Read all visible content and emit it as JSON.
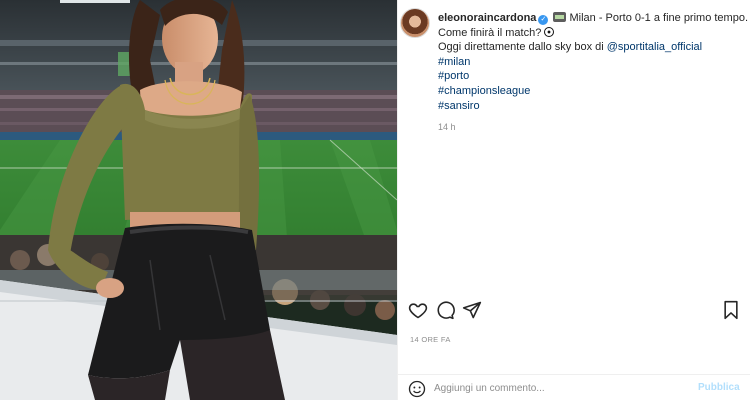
{
  "post": {
    "username": "eleonoraincardona",
    "verified": true,
    "caption_text": "Milan - Porto 0-1 a fine primo tempo. Come finirà il match?",
    "caption_line2_prefix": "Oggi direttamente dallo sky box di",
    "mention": "@sportitalia_official",
    "hashtags": [
      "#milan",
      "#porto",
      "#championsleague",
      "#sansiro"
    ],
    "comment_time": "14 h",
    "date_label": "14 ORE FA",
    "icons": {
      "verified": "verified-badge-icon",
      "stadium": "stadium-emoji-icon",
      "ball": "soccer-ball-emoji-icon"
    }
  },
  "actions": {
    "like_icon": "heart-icon",
    "comment_icon": "comment-icon",
    "share_icon": "share-icon",
    "save_icon": "bookmark-icon"
  },
  "comment": {
    "placeholder": "Aggiungi un commento...",
    "publish_label": "Pubblica",
    "emoji_icon": "emoji-smiley-icon"
  },
  "colors": {
    "link": "#00376b",
    "publish": "#b2dffc",
    "verified": "#3897f0",
    "muted": "#8e8e8e"
  }
}
